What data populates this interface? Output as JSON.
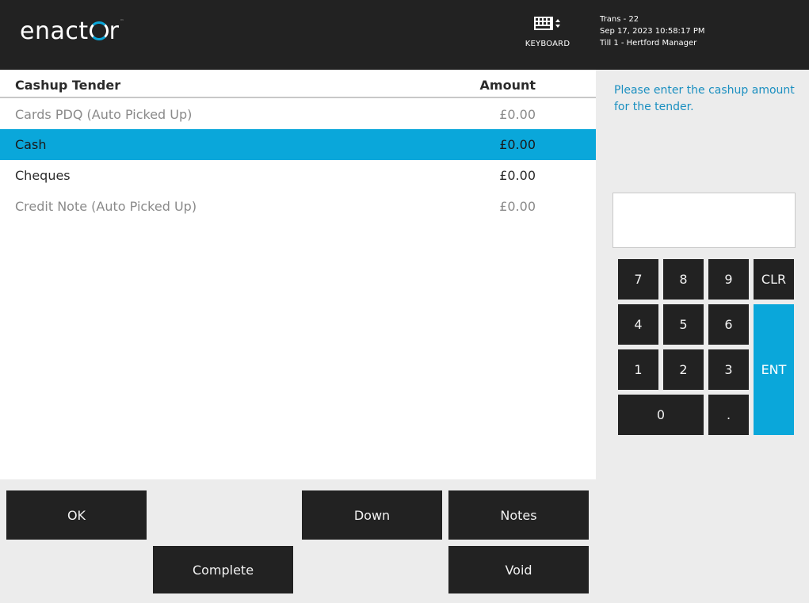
{
  "header": {
    "logo_text_pre": "enact",
    "logo_text_post": "r",
    "logo_tm": "™",
    "keyboard_label": "KEYBOARD",
    "trans": "Trans - 22",
    "datetime": "Sep 17, 2023 10:58:17 PM",
    "till": "Till 1 - Hertford Manager"
  },
  "table": {
    "col_tender": "Cashup Tender",
    "col_amount": "Amount",
    "rows": [
      {
        "name": "Cards PDQ (Auto Picked Up)",
        "amount": "£0.00",
        "state": "disabled"
      },
      {
        "name": "Cash",
        "amount": "£0.00",
        "state": "selected"
      },
      {
        "name": "Cheques",
        "amount": "£0.00",
        "state": "normal"
      },
      {
        "name": "Credit Note (Auto Picked Up)",
        "amount": "£0.00",
        "state": "disabled"
      }
    ]
  },
  "prompt": "Please enter the cashup amount for the tender.",
  "entry_value": "",
  "keypad": {
    "k7": "7",
    "k8": "8",
    "k9": "9",
    "clr": "CLR",
    "k4": "4",
    "k5": "5",
    "k6": "6",
    "k1": "1",
    "k2": "2",
    "k3": "3",
    "ent": "ENT",
    "k0": "0",
    "dot": "."
  },
  "buttons": {
    "ok": "OK",
    "down": "Down",
    "notes": "Notes",
    "complete": "Complete",
    "void": "Void"
  },
  "colors": {
    "accent": "#0aa7da",
    "header_bg": "#222222",
    "button_bg": "#222222",
    "prompt_text": "#1a8fc0"
  },
  "icons": {
    "keyboard": "keyboard-icon"
  }
}
